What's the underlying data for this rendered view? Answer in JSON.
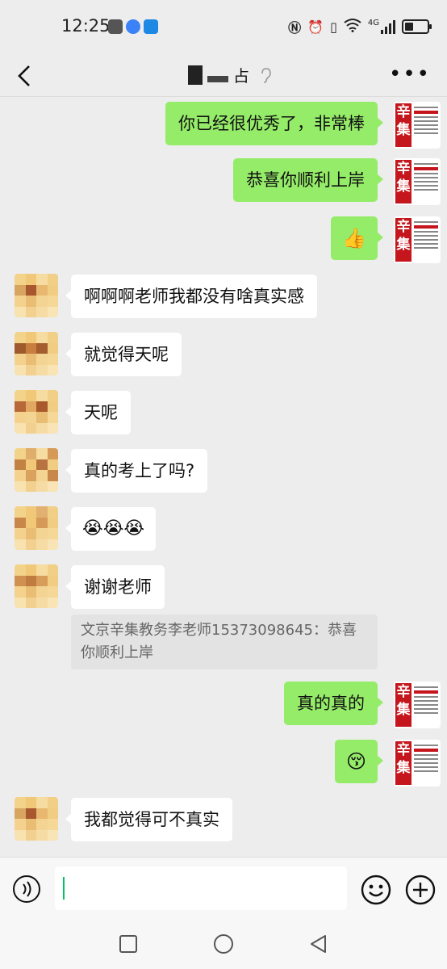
{
  "status_bar": {
    "time": "12:25",
    "network_label": "4G"
  },
  "header": {
    "title_suffix": "占"
  },
  "messages": {
    "m1": "你已经很优秀了，非常棒",
    "m2": "恭喜你顺利上岸",
    "m3": "👍",
    "m4": "啊啊啊老师我都没有啥真实感",
    "m5": "就觉得天呢",
    "m6": "天呢",
    "m7": "真的考上了吗?",
    "m8": "😭😭😭",
    "m9": "谢谢老师",
    "m9_quote": "文京辛集教务李老师15373098645：恭喜你顺利上岸",
    "m10": "真的真的",
    "m11": "😚",
    "m12": "我都觉得可不真实"
  },
  "avatar_me": {
    "char1": "辛",
    "char2": "集"
  },
  "colors": {
    "my_bubble": "#95ec69",
    "their_bubble": "#ffffff",
    "background": "#ededed",
    "accent": "#07c160"
  },
  "icons": [
    "back-arrow-icon",
    "ear-icon",
    "more-icon",
    "voice-icon",
    "emoji-icon",
    "plus-icon",
    "square-nav-icon",
    "circle-nav-icon",
    "triangle-nav-icon"
  ]
}
